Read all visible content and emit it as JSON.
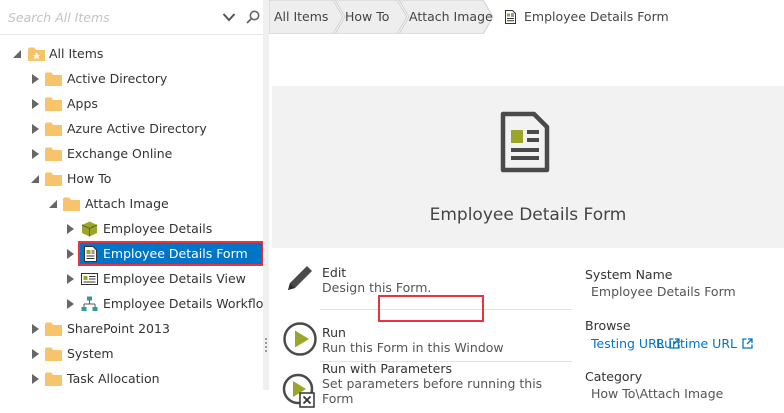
{
  "search": {
    "placeholder": "Search All Items"
  },
  "tree": {
    "root": "All Items",
    "items": {
      "active_directory": "Active Directory",
      "apps": "Apps",
      "azure_ad": "Azure Active Directory",
      "exchange": "Exchange Online",
      "how_to": "How To",
      "attach_image": "Attach Image",
      "employee_details": "Employee Details",
      "employee_details_form": "Employee Details Form",
      "employee_details_view": "Employee Details View",
      "employee_details_workflow": "Employee Details Workflow",
      "sharepoint": "SharePoint 2013",
      "system": "System",
      "task_allocation": "Task Allocation"
    }
  },
  "breadcrumb": {
    "items": [
      "All Items",
      "How To",
      "Attach Image"
    ],
    "current": "Employee Details Form"
  },
  "banner": {
    "title": "Employee Details Form"
  },
  "actions": [
    {
      "title": "Edit",
      "desc": "Design this Form."
    },
    {
      "title": "Run",
      "desc": "Run this Form in this Window"
    },
    {
      "title": "Run with Parameters",
      "desc": "Set parameters before running this Form"
    }
  ],
  "properties": {
    "system_name_label": "System Name",
    "system_name_value": "Employee Details Form",
    "browse_label": "Browse",
    "testing_url": "Testing URL",
    "runtime_url": "Runtime URL",
    "category_label": "Category",
    "category_value": "How To\\Attach Image"
  },
  "colors": {
    "selection": "#0075c8",
    "highlight_outline": "#e9343f",
    "link": "#0075c8",
    "folder": "#f7c46c",
    "run_accent": "#9aa52a",
    "banner_bg": "#f2f2f2"
  }
}
